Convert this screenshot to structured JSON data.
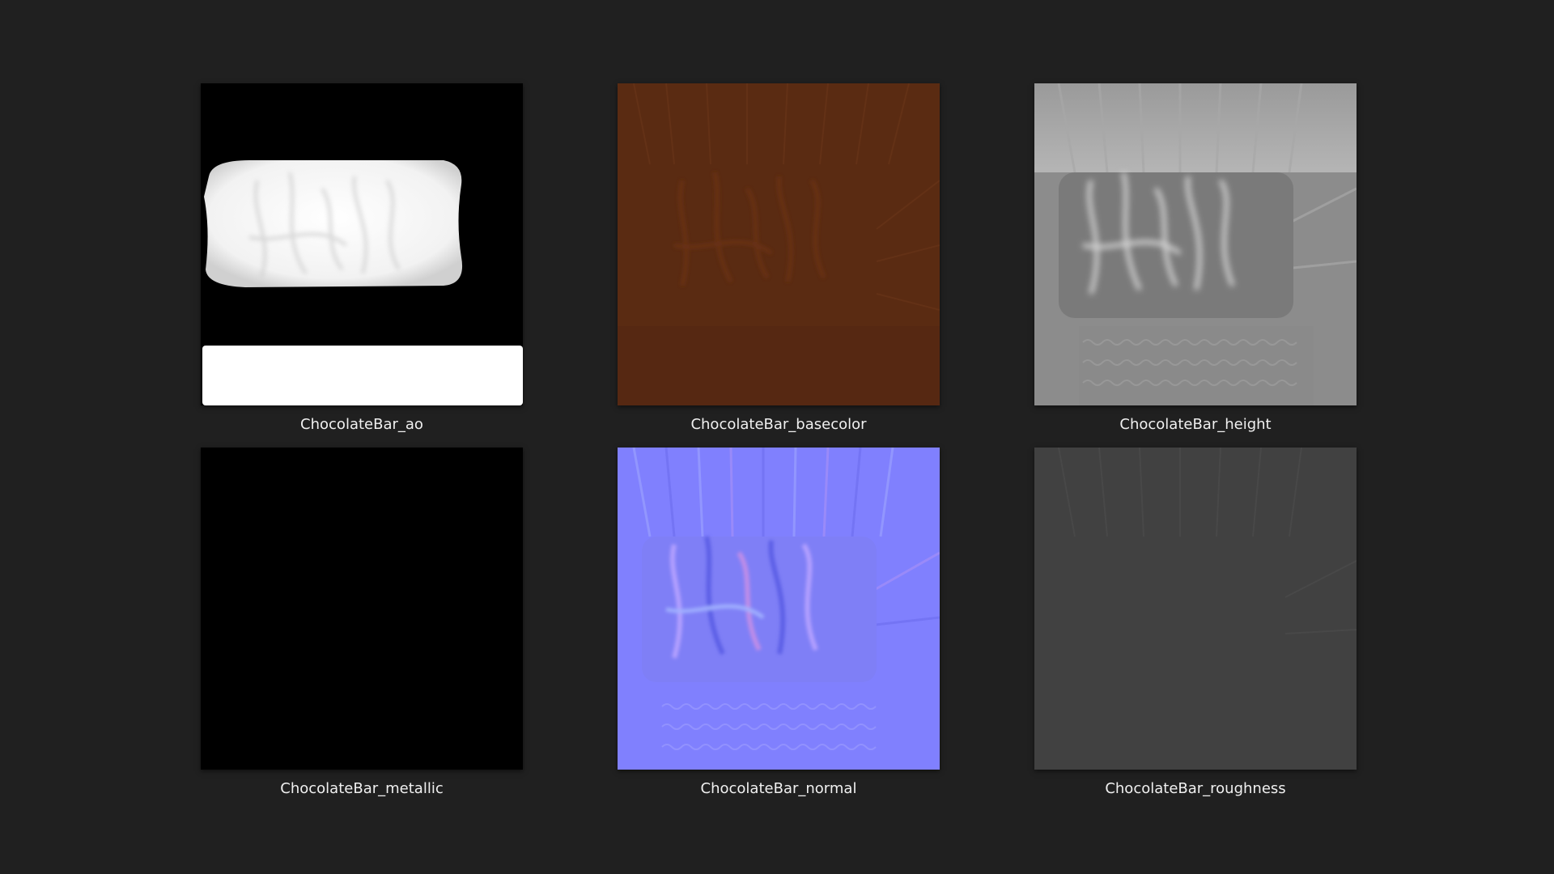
{
  "gallery": {
    "background_color": "#202020",
    "items": [
      {
        "label": "ChocolateBar_ao",
        "map_type": "ambient-occlusion",
        "base_color": "#000000"
      },
      {
        "label": "ChocolateBar_basecolor",
        "map_type": "basecolor",
        "base_color": "#5a2b12"
      },
      {
        "label": "ChocolateBar_height",
        "map_type": "height",
        "base_color": "#8c8c8c"
      },
      {
        "label": "ChocolateBar_metallic",
        "map_type": "metallic",
        "base_color": "#000000"
      },
      {
        "label": "ChocolateBar_normal",
        "map_type": "normal",
        "base_color": "#8080fe"
      },
      {
        "label": "ChocolateBar_roughness",
        "map_type": "roughness",
        "base_color": "#414141"
      }
    ]
  }
}
